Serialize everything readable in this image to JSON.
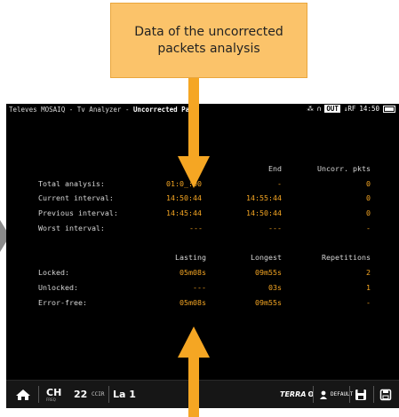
{
  "callout": {
    "text": "Data of the uncorrected packets analysis"
  },
  "topbar": {
    "prefix": "Televes MOSAIQ",
    "title_sep": " - Tv Analyzer - ",
    "page": "Uncorrected Pa",
    "page_tail": "s",
    "out_badge": "OUT",
    "rf": "↓RF",
    "time": "14:50"
  },
  "table1": {
    "headers": {
      "start": "rt",
      "end": "End",
      "uncorr": "Uncorr. pkts"
    },
    "rows": [
      {
        "label": "Total analysis:",
        "start": "01:0_:00",
        "end": "-",
        "uncorr": "0"
      },
      {
        "label": "Current interval:",
        "start": "14:50:44",
        "end": "14:55:44",
        "uncorr": "0"
      },
      {
        "label": "Previous interval:",
        "start": "14:45:44",
        "end": "14:50:44",
        "uncorr": "0"
      },
      {
        "label": "Worst interval:",
        "start": "---",
        "end": "---",
        "uncorr": "-"
      }
    ]
  },
  "table2": {
    "headers": {
      "lasting": "Lasting",
      "longest": "Longest",
      "repetitions": "Repetitions"
    },
    "rows": [
      {
        "label": "Locked:",
        "lasting": "05m08s",
        "longest": "09m55s",
        "repetitions": "2"
      },
      {
        "label": "Unlocked:",
        "lasting": "---",
        "longest": "03s",
        "repetitions": "1"
      },
      {
        "label": "Error-free:",
        "lasting": "05m08s",
        "longest": "09m55s",
        "repetitions": "-"
      }
    ]
  },
  "bottombar": {
    "ch_label": "CH",
    "ch_sub": "FREQ",
    "channel_number": "22",
    "standard": "CCIR",
    "la_label": "La 1",
    "terra_label": "TERRA",
    "user_label": "DEFAULT"
  },
  "colors": {
    "accent": "#f5a623",
    "callout_bg": "#fbc36a",
    "screen_bg": "#000000"
  }
}
